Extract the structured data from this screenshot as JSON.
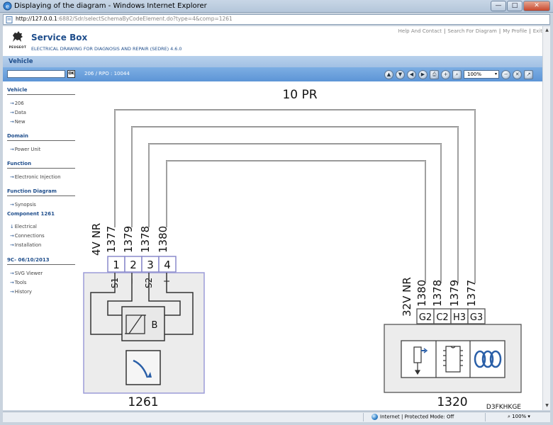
{
  "window": {
    "title": "Displaying of the diagram - Windows Internet Explorer",
    "url_host": "http://127.0.0.1",
    "url_rest": ":6882/Sdr/selectSchemaByCodeElement.do?type=4&comp=1261",
    "buttons": {
      "minimize": "—",
      "maximize": "□",
      "close": "✕"
    }
  },
  "header": {
    "brand": "PEUGEOT",
    "app_title": "Service Box",
    "subtitle": "ELECTRICAL DRAWING FOR DIAGNOSIS AND REPAIR (SEDRE) 4.6.0",
    "links": [
      "Help And Contact",
      "Search For Diagram",
      "My Profile",
      "Exit"
    ],
    "separator": "|"
  },
  "tabbar": {
    "active_tab": "Vehicle"
  },
  "toolbar": {
    "search_value": "",
    "ok_label": "OK",
    "breadcrumb": "206  /  RPO : 10044",
    "zoom": "100%",
    "zoom_caret": "▾"
  },
  "sidebar": {
    "sections": [
      {
        "heading": "Vehicle",
        "items": [
          "206",
          "Data",
          "New"
        ]
      },
      {
        "heading": "Domain",
        "items": [
          "Power Unit"
        ]
      },
      {
        "heading": "Function",
        "items": [
          "Electronic Injection"
        ]
      },
      {
        "heading": "Function Diagram",
        "items": [
          "Synopsis"
        ]
      },
      {
        "heading": "Component 1261",
        "items": [
          "Electrical",
          "Connections",
          "Installation"
        ]
      },
      {
        "heading": "9C- 06/10/2013",
        "items": [
          "SVG Viewer",
          "Tools",
          "History"
        ]
      }
    ],
    "arrow": "→",
    "active_arrow": "↓"
  },
  "diagram": {
    "harness": "10 PR",
    "left_component": {
      "code": "1261",
      "connector": "4V NR",
      "pins": [
        "1",
        "2",
        "3",
        "4"
      ],
      "wires": [
        "1377",
        "1379",
        "1378",
        "1380"
      ],
      "signals": [
        "S1",
        "−",
        "S2",
        "+"
      ],
      "sensor_label": "B"
    },
    "right_component": {
      "code": "1320",
      "connector": "32V NR",
      "pins": [
        "G2",
        "C2",
        "H3",
        "G3"
      ],
      "wires": [
        "1380",
        "1378",
        "1379",
        "1377"
      ]
    },
    "reference": "D3FKHKGE"
  },
  "status": {
    "zone": "Internet | Protected Mode: Off",
    "zoom": "100%"
  }
}
